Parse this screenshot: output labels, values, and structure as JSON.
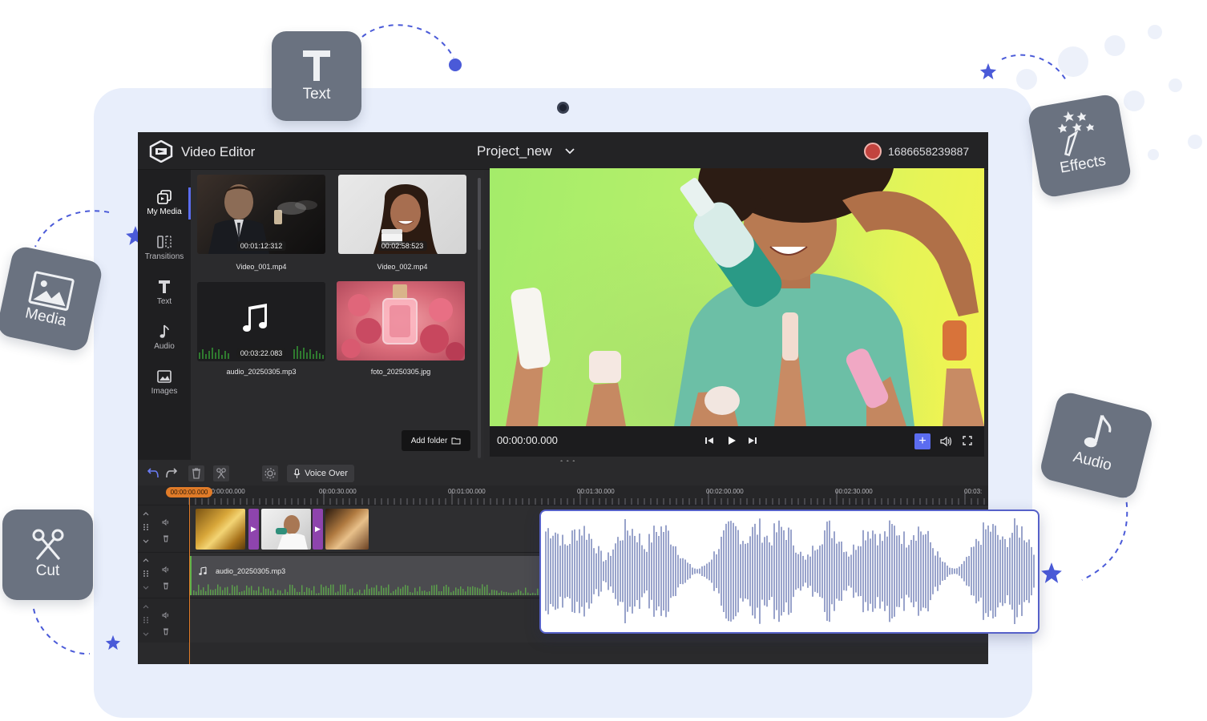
{
  "app": {
    "title": "Video Editor",
    "project_name": "Project_new",
    "user_id": "1686658239887"
  },
  "floaters": {
    "text": "Text",
    "media": "Media",
    "cut": "Cut",
    "effects": "Effects",
    "audio": "Audio"
  },
  "sidebar": {
    "items": [
      {
        "label": "My Media",
        "icon": "my-media-icon",
        "active": true
      },
      {
        "label": "Transitions",
        "icon": "transitions-icon"
      },
      {
        "label": "Text",
        "icon": "text-icon"
      },
      {
        "label": "Audio",
        "icon": "audio-icon"
      },
      {
        "label": "Images",
        "icon": "images-icon"
      }
    ]
  },
  "media": {
    "items": [
      {
        "name": "Video_001.mp4",
        "duration": "00:01:12:312",
        "kind": "video"
      },
      {
        "name": "Video_002.mp4",
        "duration": "00:02:58:523",
        "kind": "video"
      },
      {
        "name": "audio_20250305.mp3",
        "duration": "00:03:22.083",
        "kind": "audio"
      },
      {
        "name": "foto_20250305.jpg",
        "kind": "image"
      }
    ],
    "add_folder": "Add folder"
  },
  "player": {
    "timecode": "00:00:00.000"
  },
  "timeline": {
    "voice_over": "Voice Over",
    "playhead_time": "00:00:00.000",
    "ruler_labels": [
      "00:00:00.000",
      "00:00:30.000",
      "00:01:00.000",
      "00:01:30.000",
      "00:02:00.000",
      "00:02:30.000",
      "00:03:"
    ],
    "audio_clip_name": "audio_20250305.mp3"
  },
  "colors": {
    "accent": "#5b6cf0",
    "playhead": "#e07b28",
    "transition": "#8e44ad",
    "audio_clip_edge": "#5fb34a",
    "waveform": "#5566a8"
  }
}
